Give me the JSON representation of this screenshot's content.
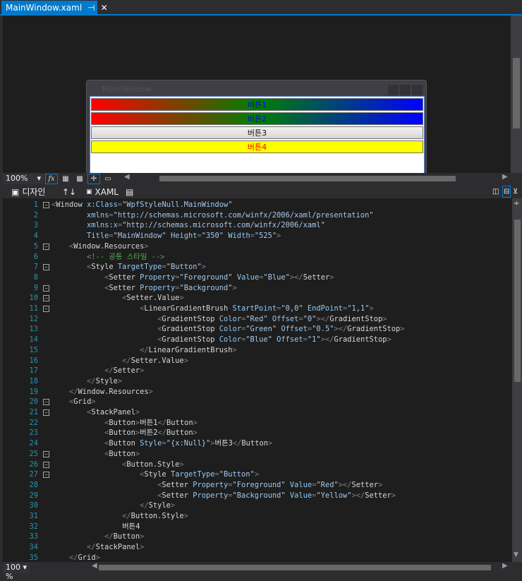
{
  "tab": {
    "title": "MainWindow.xaml",
    "pin": "⊣",
    "close": "✕"
  },
  "preview": {
    "window_title": "MainWindow",
    "buttons": [
      "버튼1",
      "버튼2",
      "버튼3",
      "버튼4"
    ]
  },
  "toolbar": {
    "zoom": "100%",
    "fx": "fx"
  },
  "view_tabs": {
    "design": "디자인",
    "swap": "↑↓",
    "xaml": "XAML"
  },
  "bottom": {
    "zoom": "100 %"
  },
  "code_lines": [
    "<Window x:Class=\"WpfStyleNull.MainWindow\"",
    "        xmlns=\"http://schemas.microsoft.com/winfx/2006/xaml/presentation\"",
    "        xmlns:x=\"http://schemas.microsoft.com/winfx/2006/xaml\"",
    "        Title=\"MainWindow\" Height=\"350\" Width=\"525\">",
    "    <Window.Resources>",
    "        <!-- 공통 스타일 -->",
    "        <Style TargetType=\"Button\">",
    "            <Setter Property=\"Foreground\" Value=\"Blue\"></Setter>",
    "            <Setter Property=\"Background\">",
    "                <Setter.Value>",
    "                    <LinearGradientBrush StartPoint=\"0,0\" EndPoint=\"1,1\">",
    "                        <GradientStop Color=\"Red\" Offset=\"0\"></GradientStop>",
    "                        <GradientStop Color=\"Green\" Offset=\"0.5\"></GradientStop>",
    "                        <GradientStop Color=\"Blue\" Offset=\"1\"></GradientStop>",
    "                    </LinearGradientBrush>",
    "                </Setter.Value>",
    "            </Setter>",
    "        </Style>",
    "    </Window.Resources>",
    "    <Grid>",
    "        <StackPanel>",
    "            <Button>버튼1</Button>",
    "            <Button>버튼2</Button>",
    "            <Button Style=\"{x:Null}\">버튼3</Button>",
    "            <Button>",
    "                <Button.Style>",
    "                    <Style TargetType=\"Button\">",
    "                        <Setter Property=\"Foreground\" Value=\"Red\"></Setter>",
    "                        <Setter Property=\"Background\" Value=\"Yellow\"></Setter>",
    "                    </Style>",
    "                </Button.Style>",
    "                버튼4",
    "            </Button>",
    "        </StackPanel>",
    "    </Grid>"
  ],
  "fold_lines": [
    1,
    5,
    7,
    9,
    10,
    11,
    20,
    21,
    25,
    26,
    27
  ]
}
